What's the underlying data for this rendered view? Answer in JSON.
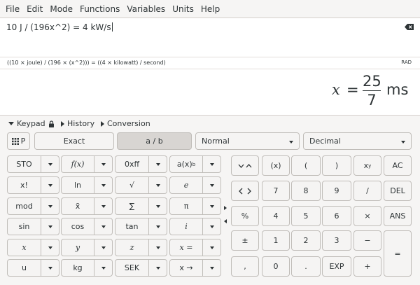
{
  "menu": [
    "File",
    "Edit",
    "Mode",
    "Functions",
    "Variables",
    "Units",
    "Help"
  ],
  "expression": {
    "text": "10 J / (196x^2) = 4 kW/s"
  },
  "parsed": {
    "text": "((10 × joule) / (196 × (x^2))) = ((4 × kilowatt) / second)",
    "angle": "RAD"
  },
  "result": {
    "var": "x",
    "eq": "=",
    "numerator": "25",
    "denominator": "7",
    "unit": "ms"
  },
  "tabs": {
    "keypad": "Keypad",
    "history": "History",
    "conversion": "Conversion"
  },
  "toolbar": {
    "p": "P",
    "exact": "Exact",
    "fraction": "a / b",
    "mode": "Normal",
    "base": "Decimal"
  },
  "fn": {
    "sto": "STO",
    "fx": "f(x)",
    "hex": "0xff",
    "ax": "a(x)",
    "ax_sup": "b",
    "fact": "x!",
    "ln": "ln",
    "sqrt": "√",
    "e": "e",
    "mod": "mod",
    "mean": "x̄",
    "sum": "∑",
    "pi": "π",
    "sin": "sin",
    "cos": "cos",
    "tan": "tan",
    "i": "i",
    "x": "x",
    "y": "y",
    "z": "z",
    "xeq": "x =",
    "u": "u",
    "kg": "kg",
    "sek": "SEK",
    "xto": "x →"
  },
  "pad": {
    "par": "(x)",
    "lp": "(",
    "rp": ")",
    "pow": "x",
    "pow_sup": "y",
    "ac": "AC",
    "n7": "7",
    "n8": "8",
    "n9": "9",
    "div": "/",
    "del": "DEL",
    "pct": "%",
    "n4": "4",
    "n5": "5",
    "n6": "6",
    "mul": "×",
    "ans": "ANS",
    "pm": "±",
    "n1": "1",
    "n2": "2",
    "n3": "3",
    "minus": "−",
    "equals": "=",
    "comma": ",",
    "n0": "0",
    "dot": ".",
    "exp": "EXP",
    "plus": "+"
  }
}
